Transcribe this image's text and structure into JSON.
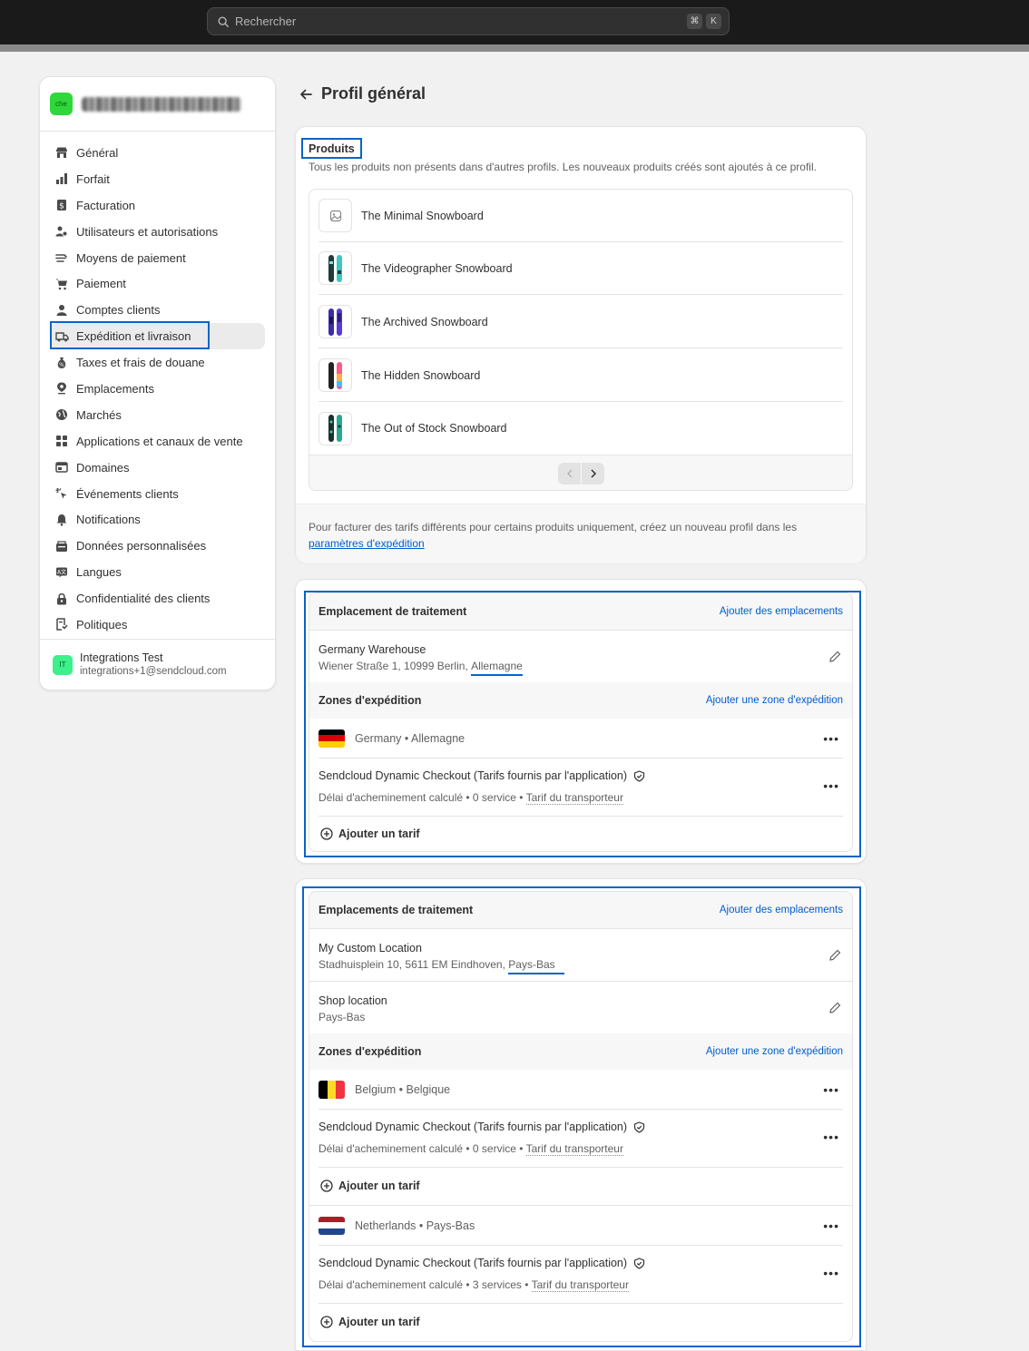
{
  "search": {
    "placeholder": "Rechercher",
    "shortcut_1": "⌘",
    "shortcut_2": "K"
  },
  "store": {
    "avatar": "che"
  },
  "sidebar": {
    "items": [
      {
        "label": "Général",
        "icon": "store-icon"
      },
      {
        "label": "Forfait",
        "icon": "plan-icon"
      },
      {
        "label": "Facturation",
        "icon": "billing-icon"
      },
      {
        "label": "Utilisateurs et autorisations",
        "icon": "users-icon"
      },
      {
        "label": "Moyens de paiement",
        "icon": "payment-icon"
      },
      {
        "label": "Paiement",
        "icon": "cart-icon"
      },
      {
        "label": "Comptes clients",
        "icon": "person-icon"
      },
      {
        "label": "Expédition et livraison",
        "icon": "truck-icon",
        "active": true
      },
      {
        "label": "Taxes et frais de douane",
        "icon": "tax-icon"
      },
      {
        "label": "Emplacements",
        "icon": "location-icon"
      },
      {
        "label": "Marchés",
        "icon": "globe-icon"
      },
      {
        "label": "Applications et canaux de vente",
        "icon": "apps-icon"
      },
      {
        "label": "Domaines",
        "icon": "domain-icon"
      },
      {
        "label": "Événements clients",
        "icon": "events-icon"
      },
      {
        "label": "Notifications",
        "icon": "bell-icon"
      },
      {
        "label": "Données personnalisées",
        "icon": "data-icon"
      },
      {
        "label": "Langues",
        "icon": "language-icon"
      },
      {
        "label": "Confidentialité des clients",
        "icon": "lock-icon"
      },
      {
        "label": "Politiques",
        "icon": "policy-icon"
      }
    ],
    "user": {
      "avatar": "IT",
      "name": "Integrations Test",
      "email": "integrations+1@sendcloud.com"
    }
  },
  "page": {
    "title": "Profil général"
  },
  "products": {
    "title": "Produits",
    "description": "Tous les produits non présents dans d'autres profils. Les nouveaux produits créés sont ajoutés à ce profil.",
    "items": [
      {
        "name": "The Minimal Snowboard"
      },
      {
        "name": "The Videographer Snowboard"
      },
      {
        "name": "The Archived Snowboard"
      },
      {
        "name": "The Hidden Snowboard"
      },
      {
        "name": "The Out of Stock Snowboard"
      }
    ],
    "footer_text": "Pour facturer des tarifs différents pour certains produits uniquement, créez un nouveau profil dans les",
    "footer_link": "paramètres d'expédition"
  },
  "group1": {
    "header": "Emplacement de traitement",
    "add_locations": "Ajouter des emplacements",
    "location": {
      "name": "Germany Warehouse",
      "address": "Wiener Straße 1, 10999 Berlin,",
      "country": "Allemagne"
    },
    "zones_header": "Zones d'expédition",
    "add_zone": "Ajouter une zone d'expédition",
    "zone": {
      "name": "Germany • Allemagne"
    },
    "rate": {
      "title": "Sendcloud Dynamic Checkout (Tarifs fournis par l'application)",
      "details": "Délai d'acheminement calculé • 0 service •",
      "carrier": "Tarif du transporteur"
    },
    "add_rate": "Ajouter un tarif"
  },
  "group2": {
    "header": "Emplacements de traitement",
    "add_locations": "Ajouter des emplacements",
    "location1": {
      "name": "My Custom Location",
      "address": "Stadhuisplein 10, 5611 EM Eindhoven,",
      "country": "Pays-Bas"
    },
    "location2": {
      "name": "Shop location",
      "address": "Pays-Bas"
    },
    "zones_header": "Zones d'expédition",
    "add_zone": "Ajouter une zone d'expédition",
    "zone1": {
      "name": "Belgium • Belgique"
    },
    "rate1": {
      "title": "Sendcloud Dynamic Checkout (Tarifs fournis par l'application)",
      "details": "Délai d'acheminement calculé • 0 service •",
      "carrier": "Tarif du transporteur"
    },
    "add_rate1": "Ajouter un tarif",
    "zone2": {
      "name": "Netherlands • Pays-Bas"
    },
    "rate2": {
      "title": "Sendcloud Dynamic Checkout (Tarifs fournis par l'application)",
      "details": "Délai d'acheminement calculé • 3 services •",
      "carrier": "Tarif du transporteur"
    },
    "add_rate2": "Ajouter un tarif"
  },
  "colors": {
    "accent": "#0a64c9",
    "link": "#005bd3",
    "store_avatar": "#2fd83a",
    "user_avatar": "#3cf08a"
  }
}
